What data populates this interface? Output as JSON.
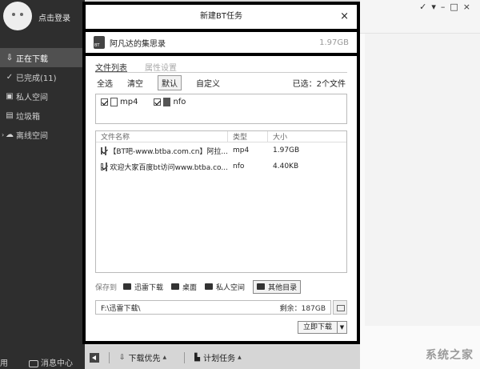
{
  "sidebar": {
    "login_label": "点击登录",
    "items": [
      {
        "label": "正在下载",
        "icon": "download-icon"
      },
      {
        "label": "已完成(11)",
        "icon": "check-circle-icon"
      },
      {
        "label": "私人空间",
        "icon": "lock-icon"
      },
      {
        "label": "垃圾箱",
        "icon": "trash-icon"
      },
      {
        "label": "离线空间",
        "icon": "cloud-icon"
      }
    ],
    "bottom_left": "用",
    "message_center": "消息中心"
  },
  "background": {
    "watermark": "系统之家"
  },
  "dialog": {
    "title": "新建BT任务",
    "close_glyph": "×",
    "task_name": "阿凡达的集思录",
    "task_size": "1.97GB",
    "tabs": [
      "文件列表",
      "属性设置"
    ],
    "filters": {
      "select_all": "全选",
      "clear": "清空",
      "default": "默认",
      "custom": "自定义",
      "selected_count": "已选：2个文件"
    },
    "types": [
      {
        "label": "mp4",
        "checked": true
      },
      {
        "label": "nfo",
        "checked": true
      }
    ],
    "file_table": {
      "headers": [
        "文件名称",
        "类型",
        "大小"
      ],
      "rows": [
        {
          "name": "【BT吧-www.btba.com.cn】阿拉...",
          "type": "mp4",
          "size": "1.97GB"
        },
        {
          "name": "欢迎大家百度bt访问www.btba.co...",
          "type": "nfo",
          "size": "4.40KB"
        }
      ]
    },
    "save_to": {
      "label": "保存到",
      "options": [
        "迅雷下载",
        "桌面",
        "私人空间",
        "其他目录"
      ]
    },
    "path": {
      "value": "F:\\迅雷下载\\",
      "free_space": "剩余：187GB"
    },
    "download_button": "立即下载"
  },
  "bottom_bar": {
    "priority": "下载优先",
    "schedule": "计划任务"
  }
}
